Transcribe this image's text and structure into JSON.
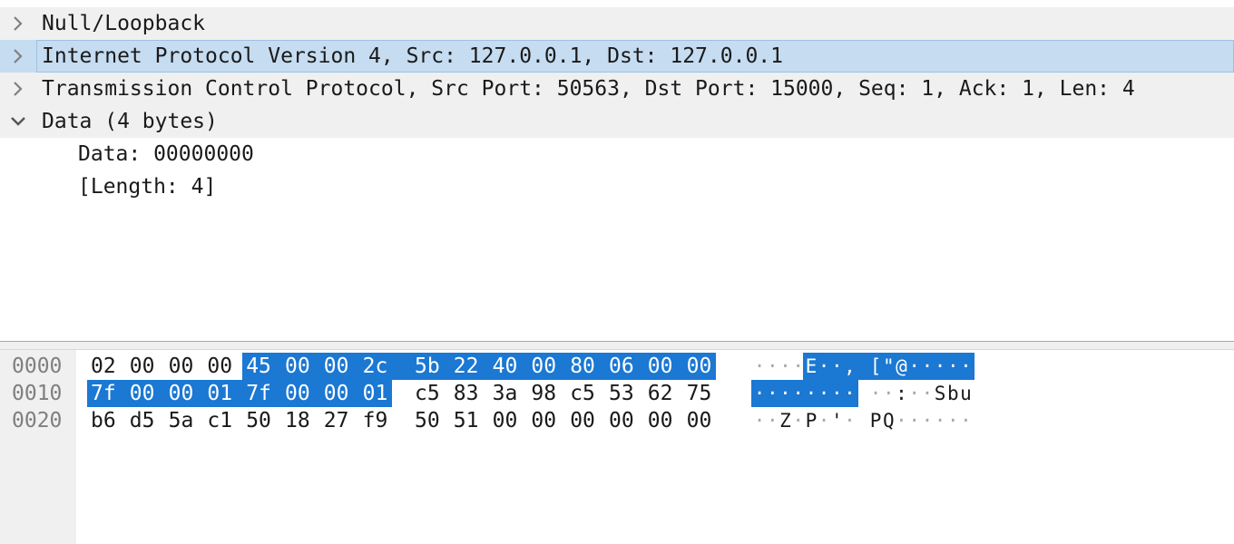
{
  "tree": {
    "rows": [
      {
        "label": "Null/Loopback",
        "expanded": false,
        "selected": false
      },
      {
        "label": "Internet Protocol Version 4, Src: 127.0.0.1, Dst: 127.0.0.1",
        "expanded": false,
        "selected": true
      },
      {
        "label": "Transmission Control Protocol, Src Port: 50563, Dst Port: 15000, Seq: 1, Ack: 1, Len: 4",
        "expanded": false,
        "selected": false
      },
      {
        "label": "Data (4 bytes)",
        "expanded": true,
        "selected": false
      }
    ],
    "children": [
      {
        "label": "Data: 00000000"
      },
      {
        "label": "[Length: 4]"
      }
    ]
  },
  "bytes_pane": {
    "rows": [
      {
        "offset": "0000",
        "hex": [
          "02",
          "00",
          "00",
          "00",
          "45",
          "00",
          "00",
          "2c",
          "5b",
          "22",
          "40",
          "00",
          "80",
          "06",
          "00",
          "00"
        ],
        "ascii": [
          "·",
          "·",
          "·",
          "·",
          "E",
          "·",
          "·",
          ",",
          "[",
          "\"",
          "@",
          "·",
          "·",
          "·",
          "·",
          "·"
        ],
        "highlight_from": 4,
        "highlight_to": 15
      },
      {
        "offset": "0010",
        "hex": [
          "7f",
          "00",
          "00",
          "01",
          "7f",
          "00",
          "00",
          "01",
          "c5",
          "83",
          "3a",
          "98",
          "c5",
          "53",
          "62",
          "75"
        ],
        "ascii": [
          "·",
          "·",
          "·",
          "·",
          "·",
          "·",
          "·",
          "·",
          "·",
          "·",
          ":",
          "·",
          "·",
          "S",
          "b",
          "u"
        ],
        "highlight_from": 0,
        "highlight_to": 7
      },
      {
        "offset": "0020",
        "hex": [
          "b6",
          "d5",
          "5a",
          "c1",
          "50",
          "18",
          "27",
          "f9",
          "50",
          "51",
          "00",
          "00",
          "00",
          "00",
          "00",
          "00"
        ],
        "ascii": [
          "·",
          "·",
          "Z",
          "·",
          "P",
          "·",
          "'",
          "·",
          "P",
          "Q",
          "·",
          "·",
          "·",
          "·",
          "·",
          "·"
        ],
        "highlight_from": -1,
        "highlight_to": -1
      }
    ]
  },
  "colors": {
    "selection_row": "#c5dcf1",
    "byte_highlight": "#1b78d3",
    "offset_text": "#7f7f7f",
    "nonprintable_dot": "#a8a8a8"
  }
}
